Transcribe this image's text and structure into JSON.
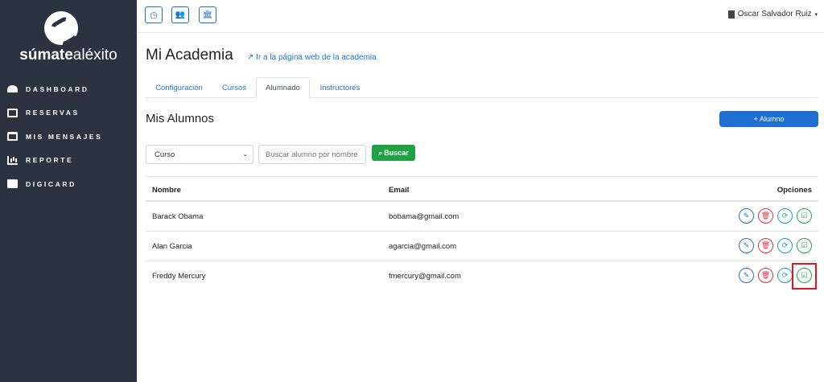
{
  "sidebar": {
    "brand_bold": "súmate",
    "brand_light": "aléxito",
    "items": [
      {
        "label": "DASHBOARD",
        "icon": "dashboard-icon"
      },
      {
        "label": "RESERVAS",
        "icon": "calendar-icon"
      },
      {
        "label": "MIS MENSAJES",
        "icon": "inbox-icon"
      },
      {
        "label": "REPORTE",
        "icon": "chart-icon"
      },
      {
        "label": "DIGICARD",
        "icon": "id-card-icon"
      }
    ]
  },
  "topbar": {
    "buttons": [
      {
        "icon": "clock-icon",
        "glyph": "◷"
      },
      {
        "icon": "users-icon",
        "glyph": "👥"
      },
      {
        "icon": "institution-icon",
        "glyph": "🏛"
      }
    ],
    "user_name": "Oscar Salvador Ruiz",
    "user_caret": "▾"
  },
  "page": {
    "title": "Mi Academia",
    "web_link": "Ir a la página web de la academia",
    "tabs": [
      {
        "label": "Configuración"
      },
      {
        "label": "Cursos"
      },
      {
        "label": "Alumnado",
        "active": true
      },
      {
        "label": "Instructores"
      }
    ],
    "section_title": "Mis Alumnos",
    "add_button": "+ Alumno"
  },
  "filters": {
    "course_select": "Curso",
    "search_placeholder": "Buscar alumno por nombre",
    "search_button": "Buscar"
  },
  "table": {
    "headers": {
      "name": "Nombre",
      "email": "Email",
      "options": "Opciones"
    },
    "rows": [
      {
        "name": "Barack Obama",
        "email": "bobama@gmail.com"
      },
      {
        "name": "Alan Garcia",
        "email": "agarcia@gmail.com"
      },
      {
        "name": "Freddy Mercury",
        "email": "fmercury@gmail.com"
      }
    ],
    "option_glyphs": {
      "edit": "✎",
      "delete": "🗑",
      "sync": "⟳",
      "check": "☑"
    }
  },
  "colors": {
    "sidebar_bg": "#2c3340",
    "primary": "#1f6fd3",
    "success": "#20a144",
    "danger": "#dc3545",
    "info": "#17a2b8",
    "highlight": "#e0161e"
  }
}
